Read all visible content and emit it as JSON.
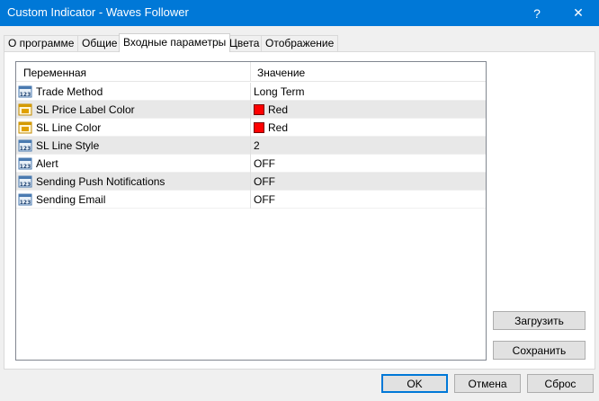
{
  "window": {
    "title": "Custom Indicator - Waves Follower",
    "help_label": "?",
    "close_label": "✕"
  },
  "tabs": [
    {
      "label": "О программе",
      "active": false
    },
    {
      "label": "Общие",
      "active": false
    },
    {
      "label": "Входные параметры",
      "active": true
    },
    {
      "label": "Цвета",
      "active": false
    },
    {
      "label": "Отображение",
      "active": false
    }
  ],
  "grid": {
    "headers": {
      "variable": "Переменная",
      "value": "Значение"
    },
    "rows": [
      {
        "icon": "number-param-icon",
        "name": "Trade Method",
        "value": "Long Term"
      },
      {
        "icon": "color-param-icon",
        "name": "SL Price Label Color",
        "value": "Red",
        "swatch": "#ff0000"
      },
      {
        "icon": "color-param-icon",
        "name": "SL Line Color",
        "value": "Red",
        "swatch": "#ff0000"
      },
      {
        "icon": "number-param-icon",
        "name": "SL Line Style",
        "value": "2"
      },
      {
        "icon": "number-param-icon",
        "name": "Alert",
        "value": "OFF"
      },
      {
        "icon": "number-param-icon",
        "name": "Sending Push Notifications",
        "value": "OFF"
      },
      {
        "icon": "number-param-icon",
        "name": "Sending Email",
        "value": "OFF"
      }
    ]
  },
  "side_buttons": {
    "load": "Загрузить",
    "save": "Сохранить"
  },
  "footer_buttons": {
    "ok": "OK",
    "cancel": "Отмена",
    "reset": "Сброс"
  },
  "colors": {
    "titlebar": "#0078d7",
    "accent": "#0078d7",
    "swatch_red": "#ff0000"
  }
}
